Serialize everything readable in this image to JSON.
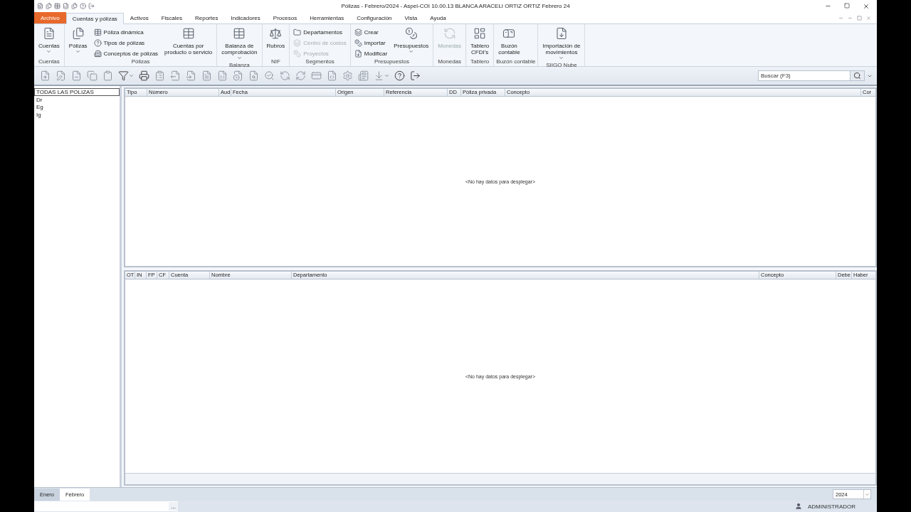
{
  "window": {
    "title": "Pólizas - Febrero/2024 - Aspel-COI 10.00.13 BLANCA ARACELI ORTIZ ORTIZ Febrero 24"
  },
  "menu": [
    {
      "label": "Archivo",
      "kind": "file",
      "selected": false
    },
    {
      "label": "Cuentas y pólizas",
      "kind": "tab",
      "selected": true
    },
    {
      "label": "Activos",
      "kind": "tab",
      "selected": false
    },
    {
      "label": "Fiscales",
      "kind": "tab",
      "selected": false
    },
    {
      "label": "Reportes",
      "kind": "tab",
      "selected": false
    },
    {
      "label": "Indicadores",
      "kind": "tab",
      "selected": false
    },
    {
      "label": "Procesos",
      "kind": "tab",
      "selected": false
    },
    {
      "label": "Herramientas",
      "kind": "tab",
      "selected": false
    },
    {
      "label": "Configuración",
      "kind": "tab",
      "selected": false
    },
    {
      "label": "Vista",
      "kind": "tab",
      "selected": false
    },
    {
      "label": "Ayuda",
      "kind": "tab",
      "selected": false
    }
  ],
  "ribbon": [
    {
      "label": "Cuentas",
      "items": [
        {
          "kind": "large",
          "lines": [
            "Cuentas"
          ],
          "dropdown": true,
          "disabled": false
        }
      ]
    },
    {
      "label": "Pólizas",
      "items": [
        {
          "kind": "large",
          "lines": [
            "Pólizas"
          ],
          "dropdown": true,
          "disabled": false
        },
        {
          "kind": "small",
          "label": "Póliza dinámica",
          "disabled": false
        },
        {
          "kind": "small",
          "label": "Tipos de pólizas",
          "disabled": false
        },
        {
          "kind": "small",
          "label": "Conceptos de pólizas",
          "disabled": false
        },
        {
          "kind": "large",
          "lines": [
            "Cuentas por",
            "producto o servicio"
          ],
          "dropdown": false,
          "disabled": false
        }
      ]
    },
    {
      "label": "Balanza",
      "items": [
        {
          "kind": "large",
          "lines": [
            "Balanza de",
            "comprobación"
          ],
          "dropdown": true,
          "disabled": false
        }
      ]
    },
    {
      "label": "NIF",
      "items": [
        {
          "kind": "large",
          "lines": [
            "Rubros"
          ],
          "dropdown": false,
          "disabled": false
        }
      ]
    },
    {
      "label": "Segmentos",
      "items": [
        {
          "kind": "small",
          "label": "Departamentos",
          "disabled": false
        },
        {
          "kind": "small",
          "label": "Centro de costos",
          "disabled": true
        },
        {
          "kind": "small",
          "label": "Proyectos",
          "disabled": true
        }
      ]
    },
    {
      "label": "Presupuestos",
      "items": [
        {
          "kind": "small",
          "label": "Crear",
          "disabled": false
        },
        {
          "kind": "small",
          "label": "Importar",
          "disabled": false
        },
        {
          "kind": "small",
          "label": "Modificar",
          "disabled": false
        },
        {
          "kind": "large",
          "lines": [
            "Presupuestos"
          ],
          "dropdown": true,
          "disabled": false
        }
      ]
    },
    {
      "label": "Monedas",
      "items": [
        {
          "kind": "large",
          "lines": [
            "Monedas"
          ],
          "dropdown": false,
          "disabled": true
        }
      ]
    },
    {
      "label": "Tablero",
      "items": [
        {
          "kind": "large",
          "lines": [
            "Tablero",
            "CFDI's"
          ],
          "dropdown": false,
          "disabled": false
        }
      ]
    },
    {
      "label": "Buzón contable",
      "items": [
        {
          "kind": "large",
          "lines": [
            "Buzón",
            "contable"
          ],
          "dropdown": false,
          "disabled": false
        }
      ]
    },
    {
      "label": "SIIGO Nube",
      "items": [
        {
          "kind": "large",
          "lines": [
            "Importación de",
            "movimientos"
          ],
          "dropdown": true,
          "disabled": false
        }
      ]
    }
  ],
  "search": {
    "placeholder": "Buscar (F3)"
  },
  "tree": [
    {
      "label": "TODAS LAS POLIZAS",
      "selected": true
    },
    {
      "label": "Dr",
      "selected": false
    },
    {
      "label": "Eg",
      "selected": false
    },
    {
      "label": "Ig",
      "selected": false
    }
  ],
  "polizas_table": {
    "columns": [
      "Tipo",
      "Número",
      "Aud",
      "Fecha",
      "Origen",
      "Referencia",
      "DD",
      "Póliza privada",
      "Concepto",
      "Cor"
    ],
    "empty_message": "<No hay datos para desplegar>"
  },
  "movimientos_table": {
    "columns": [
      "OT",
      "IN",
      "FP",
      "CF",
      "Cuenta",
      "Nombre",
      "Departamento",
      "Concepto",
      "Debe",
      "Haber"
    ],
    "empty_message": "<No hay datos para desplegar>"
  },
  "period_tabs": [
    {
      "label": "Enero",
      "selected": false
    },
    {
      "label": "Febrero",
      "selected": true
    }
  ],
  "year": {
    "value": "2024"
  },
  "status_bar": {
    "user": "ADMINISTRADOR",
    "field_button": "..."
  }
}
